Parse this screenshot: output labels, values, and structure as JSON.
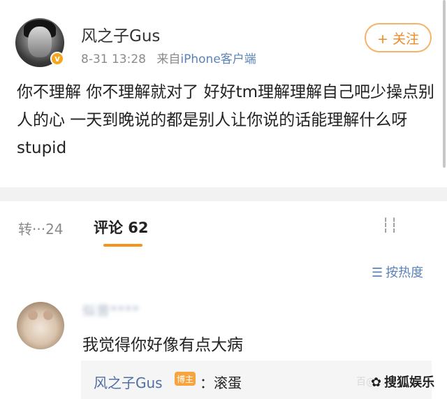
{
  "post": {
    "username": "风之子Gus",
    "timestamp": "8-31 13:28",
    "source_prefix": "来自",
    "source": "iPhone客户端",
    "follow_label": "+ 关注",
    "content": "你不理解 你不理解就对了 好好tm理解理解自己吧少操点别人的心 一天到晚说的都是别人让你说的话能理解什么呀 stupid"
  },
  "tabs": {
    "repost": "转···24",
    "comments": "评论 62",
    "likes": "┆┆"
  },
  "sort": {
    "icon": "sort-icon",
    "label": "按热度"
  },
  "comment": {
    "username_blurred": "似曾****",
    "text": "我觉得你好像有点大病",
    "reply": {
      "username": "风之子Gus",
      "badge": "博主",
      "separator": "：",
      "text": "滚蛋"
    }
  },
  "watermark": {
    "faint": "百@...",
    "label": "搜狐娱乐"
  },
  "colors": {
    "accent_orange": "#f6921e",
    "link_blue": "#5b82b8",
    "name_blue": "#4f6fa6"
  }
}
